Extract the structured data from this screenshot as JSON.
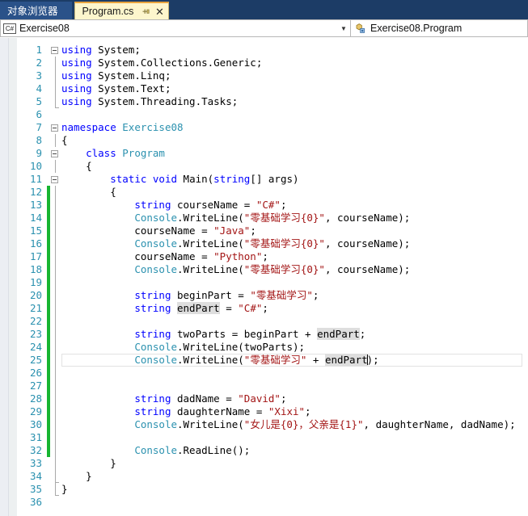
{
  "tabs": [
    {
      "label": "对象浏览器",
      "active": false
    },
    {
      "label": "Program.cs",
      "active": true,
      "pin_icon": "pin-icon",
      "close_icon": "close-icon"
    }
  ],
  "navbar": {
    "left_combo": {
      "value": "Exercise08",
      "icon": "csharp-project-icon",
      "arrow": "▼"
    },
    "right_combo": {
      "value": "Exercise08.Program",
      "icon": "class-member-icon"
    }
  },
  "editor": {
    "colors": {
      "keyword": "#0000ff",
      "string": "#a31515",
      "type": "#2b91af",
      "line_number": "#2b91af",
      "change_bar": "#17b531",
      "reference_highlight": "#dedede",
      "background": "#ffffff"
    },
    "change_bar_lines": [
      12,
      32
    ],
    "current_line": 25,
    "lines": [
      {
        "n": 1,
        "outline": "collapse",
        "text": "using System;"
      },
      {
        "n": 2,
        "outline": "bar",
        "text": "using System.Collections.Generic;"
      },
      {
        "n": 3,
        "outline": "bar",
        "text": "using System.Linq;"
      },
      {
        "n": 4,
        "outline": "bar",
        "text": "using System.Text;"
      },
      {
        "n": 5,
        "outline": "end",
        "text": "using System.Threading.Tasks;"
      },
      {
        "n": 6,
        "outline": "none",
        "text": ""
      },
      {
        "n": 7,
        "outline": "collapse",
        "text": "namespace Exercise08"
      },
      {
        "n": 8,
        "outline": "bar",
        "text": "{"
      },
      {
        "n": 9,
        "outline": "collapse",
        "text": "    class Program"
      },
      {
        "n": 10,
        "outline": "bar",
        "text": "    {"
      },
      {
        "n": 11,
        "outline": "collapse",
        "text": "        static void Main(string[] args)"
      },
      {
        "n": 12,
        "outline": "bar",
        "text": "        {"
      },
      {
        "n": 13,
        "outline": "bar",
        "text": "            string courseName = \"C#\";"
      },
      {
        "n": 14,
        "outline": "bar",
        "text": "            Console.WriteLine(\"零基础学习{0}\", courseName);"
      },
      {
        "n": 15,
        "outline": "bar",
        "text": "            courseName = \"Java\";"
      },
      {
        "n": 16,
        "outline": "bar",
        "text": "            Console.WriteLine(\"零基础学习{0}\", courseName);"
      },
      {
        "n": 17,
        "outline": "bar",
        "text": "            courseName = \"Python\";"
      },
      {
        "n": 18,
        "outline": "bar",
        "text": "            Console.WriteLine(\"零基础学习{0}\", courseName);"
      },
      {
        "n": 19,
        "outline": "bar",
        "text": ""
      },
      {
        "n": 20,
        "outline": "bar",
        "text": "            string beginPart = \"零基础学习\";"
      },
      {
        "n": 21,
        "outline": "bar",
        "text": "            string endPart = \"C#\";"
      },
      {
        "n": 22,
        "outline": "bar",
        "text": ""
      },
      {
        "n": 23,
        "outline": "bar",
        "text": "            string twoParts = beginPart + endPart;"
      },
      {
        "n": 24,
        "outline": "bar",
        "text": "            Console.WriteLine(twoParts);"
      },
      {
        "n": 25,
        "outline": "bar",
        "text": "            Console.WriteLine(\"零基础学习\" + endPart);"
      },
      {
        "n": 26,
        "outline": "bar",
        "text": ""
      },
      {
        "n": 27,
        "outline": "bar",
        "text": ""
      },
      {
        "n": 28,
        "outline": "bar",
        "text": "            string dadName = \"David\";"
      },
      {
        "n": 29,
        "outline": "bar",
        "text": "            string daughterName = \"Xixi\";"
      },
      {
        "n": 30,
        "outline": "bar",
        "text": "            Console.WriteLine(\"女儿是{0}，父亲是{1}\", daughterName, dadName);"
      },
      {
        "n": 31,
        "outline": "bar",
        "text": ""
      },
      {
        "n": 32,
        "outline": "bar",
        "text": "            Console.ReadLine();"
      },
      {
        "n": 33,
        "outline": "bar",
        "text": "        }"
      },
      {
        "n": 34,
        "outline": "end",
        "text": "    }"
      },
      {
        "n": 35,
        "outline": "end",
        "text": "}"
      },
      {
        "n": 36,
        "outline": "none",
        "text": ""
      }
    ]
  }
}
